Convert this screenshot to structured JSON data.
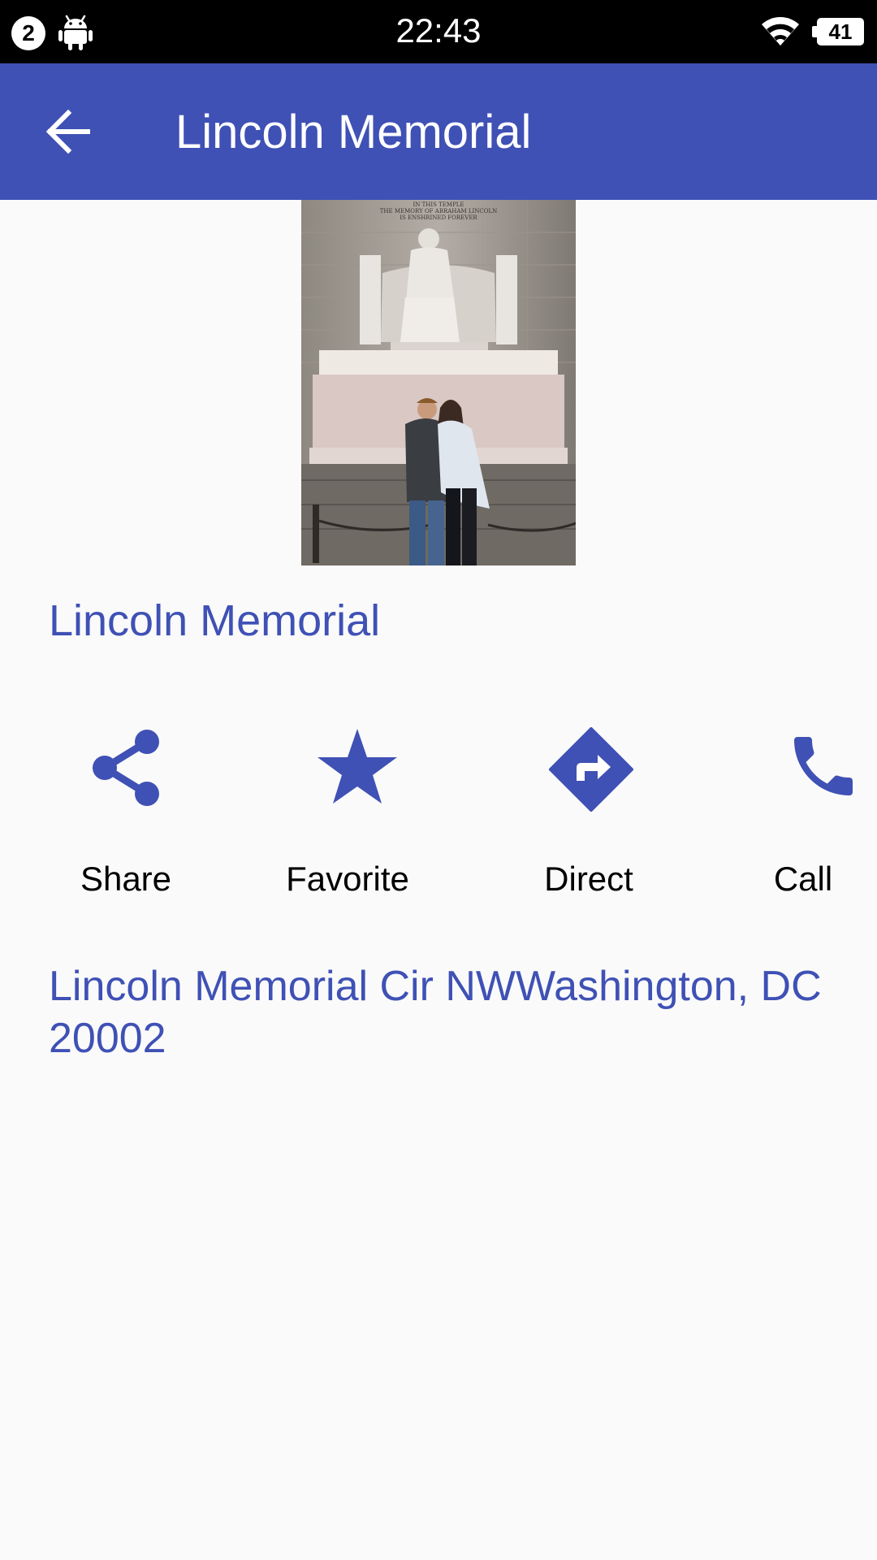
{
  "status_bar": {
    "notification_count": "2",
    "time": "22:43",
    "battery": "41"
  },
  "app_bar": {
    "title": "Lincoln Memorial",
    "back_icon": "arrow-back-icon"
  },
  "photo": {
    "inscription_line1": "IN THIS TEMPLE",
    "inscription_line2": "THE MEMORY OF ABRAHAM LINCOLN",
    "inscription_line3": "IS ENSHRINED FOREVER"
  },
  "place": {
    "name": "Lincoln Memorial",
    "address": "Lincoln Memorial Cir NWWashington, DC 20002"
  },
  "actions": [
    {
      "label": "Share",
      "icon": "share-icon"
    },
    {
      "label": "Favorite",
      "icon": "star-icon"
    },
    {
      "label": "Direct",
      "icon": "directions-icon"
    },
    {
      "label": "Call",
      "icon": "phone-icon"
    }
  ],
  "colors": {
    "primary": "#3f51b5",
    "background": "#fafafa",
    "status_bar": "#000000"
  }
}
